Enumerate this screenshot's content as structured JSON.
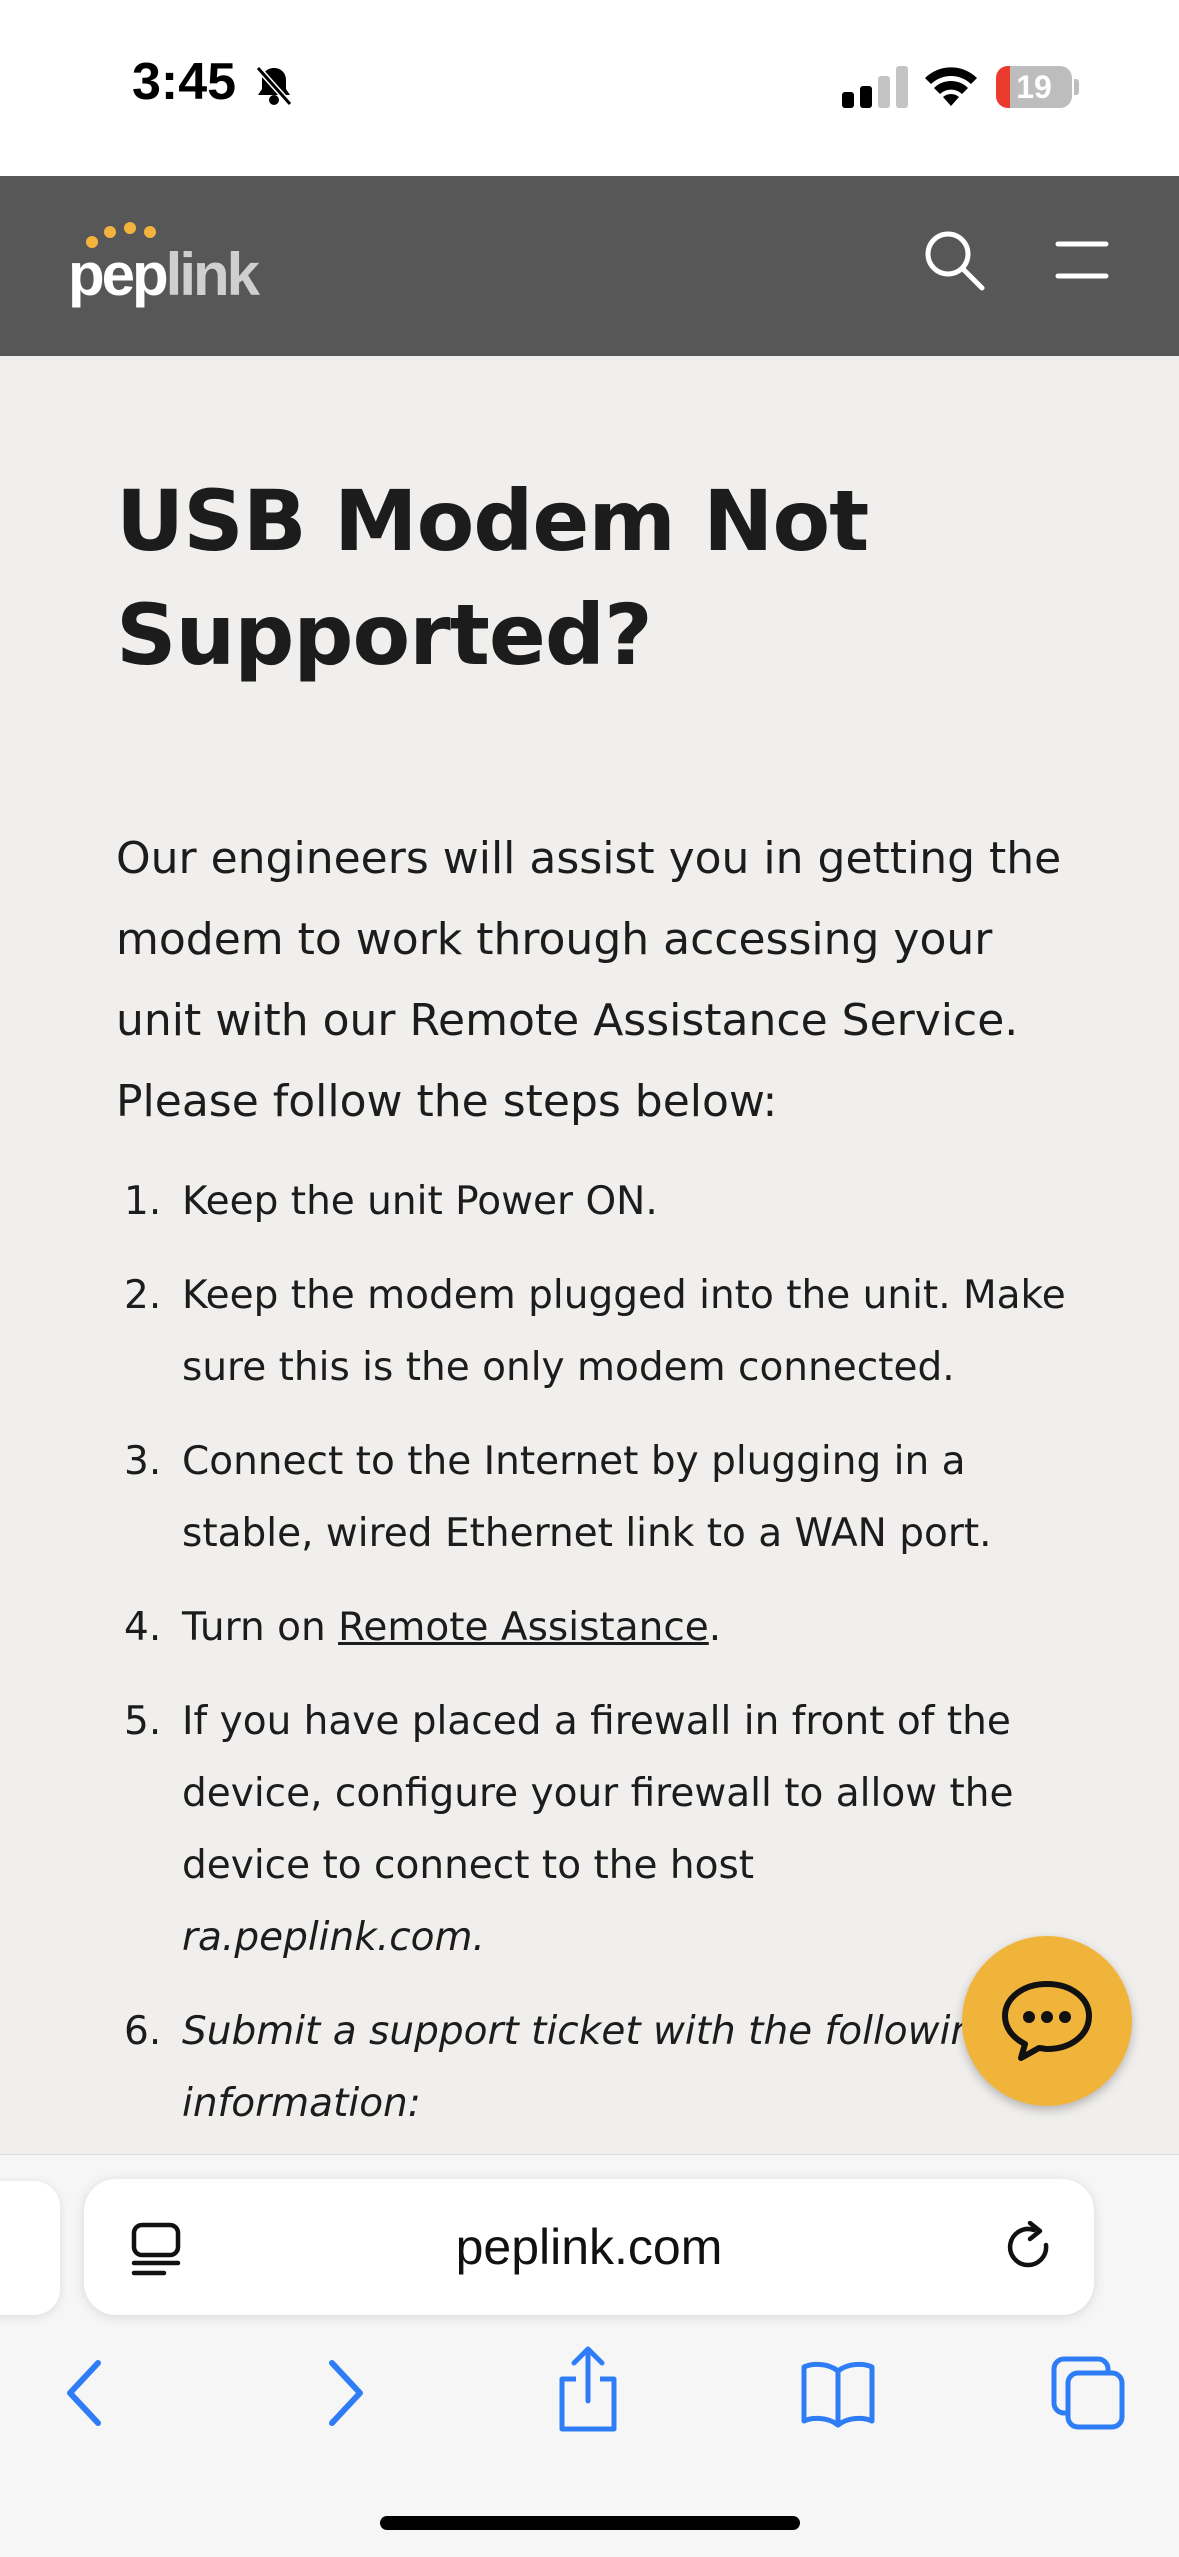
{
  "status_bar": {
    "time": "3:45",
    "battery_level": "19",
    "battery_fraction": 0.19,
    "icons": [
      "bell-slash-icon",
      "cellular-signal-icon",
      "wifi-icon",
      "battery-icon"
    ]
  },
  "header": {
    "logo_main": "pep",
    "logo_accent": "link",
    "brand_color": "#f3b33d",
    "header_bg": "#575757",
    "icons": [
      "search-icon",
      "hamburger-menu-icon"
    ]
  },
  "article": {
    "title": "USB Modem Not Supported?",
    "intro": "Our engineers will assist you in getting the modem to work through accessing your unit with our Remote Assistance Service. Please follow the steps below:",
    "steps": [
      {
        "num": "1.",
        "text": "Keep the unit Power ON."
      },
      {
        "num": "2.",
        "text": "Keep the modem plugged into the unit. Make sure this is the only modem connected."
      },
      {
        "num": "3.",
        "text": "Connect to the Internet by plugging in a stable, wired Ethernet link to a WAN port."
      },
      {
        "num": "4.",
        "prefix": "Turn on ",
        "link": "Remote Assistance",
        "suffix": "."
      },
      {
        "num": "5.",
        "text": "If you have placed a firewall in front of the device, configure your firewall to allow the device to connect to the host ",
        "host": "ra.peplink.com."
      },
      {
        "num": "6.",
        "text": "Submit a support ticket with the following information:"
      }
    ]
  },
  "chat": {
    "icon": "chat-bubble-icon",
    "color": "#f1b43b"
  },
  "browser": {
    "url": "peplink.com",
    "icons": [
      "reader-mode-icon",
      "reload-icon",
      "back-icon",
      "forward-icon",
      "share-icon",
      "bookmarks-icon",
      "tabs-icon"
    ],
    "accent_color": "#2f7df6"
  }
}
